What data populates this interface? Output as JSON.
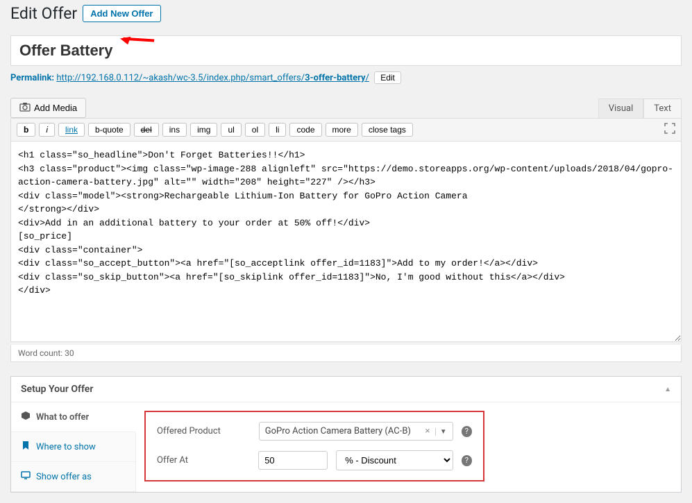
{
  "header": {
    "page_title": "Edit Offer",
    "add_new_label": "Add New Offer"
  },
  "title_field": {
    "value": "Offer Battery"
  },
  "permalink": {
    "label": "Permalink:",
    "url_base": "http://192.168.0.112/~akash/wc-3.5/index.php/smart_offers/",
    "slug": "3-offer-battery",
    "trail": "/",
    "edit_label": "Edit"
  },
  "editor": {
    "add_media_label": "Add Media",
    "tabs": {
      "visual": "Visual",
      "text": "Text"
    },
    "quicktags": {
      "b": "b",
      "i": "i",
      "link": "link",
      "bquote": "b-quote",
      "del": "del",
      "ins": "ins",
      "img": "img",
      "ul": "ul",
      "ol": "ol",
      "li": "li",
      "code": "code",
      "more": "more",
      "close": "close tags"
    },
    "content": "<h1 class=\"so_headline\">Don't Forget Batteries!!</h1>\n<h3 class=\"product\"><img class=\"wp-image-288 alignleft\" src=\"https://demo.storeapps.org/wp-content/uploads/2018/04/gopro-action-camera-battery.jpg\" alt=\"\" width=\"208\" height=\"227\" /></h3>\n<div class=\"model\"><strong>Rechargeable Lithium-Ion Battery for GoPro Action Camera\n</strong></div>\n<div>Add in an additional battery to your order at 50% off!</div>\n[so_price]\n<div class=\"container\">\n<div class=\"so_accept_button\"><a href=\"[so_acceptlink offer_id=1183]\">Add to my order!</a></div>\n<div class=\"so_skip_button\"><a href=\"[so_skiplink offer_id=1183]\">No, I'm good without this</a></div>\n</div>",
    "word_count_label": "Word count: 30"
  },
  "setup": {
    "title": "Setup Your Offer",
    "tabs": {
      "what": "What to offer",
      "where": "Where to show",
      "showas": "Show offer as"
    },
    "form": {
      "offered_product_label": "Offered Product",
      "offered_product_value": "GoPro Action Camera Battery (AC-B)",
      "offer_at_label": "Offer At",
      "offer_at_value": "50",
      "offer_at_type": "% - Discount"
    }
  }
}
